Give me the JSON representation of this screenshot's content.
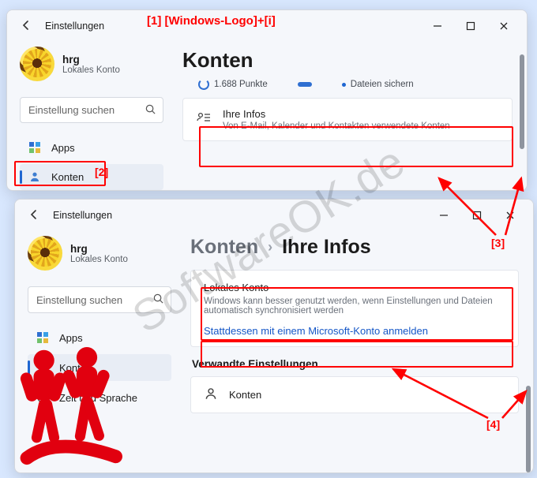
{
  "watermark": "SoftwareOK.de",
  "annotation": {
    "hotkey": "[1]  [Windows-Logo]+[i]",
    "n2": "[2]",
    "n3": "[3]",
    "n4": "[4]"
  },
  "win1": {
    "title": "Einstellungen",
    "user": {
      "name": "hrg",
      "sub": "Lokales Konto"
    },
    "search_placeholder": "Einstellung suchen",
    "heading": "Konten",
    "status": {
      "points": "1.688 Punkte",
      "backup": "Dateien sichern"
    },
    "nav": [
      {
        "icon": "apps",
        "label": "Apps"
      },
      {
        "icon": "person",
        "label": "Konten"
      }
    ],
    "card": {
      "title": "Ihre Infos",
      "sub": "Von E-Mail, Kalender und Kontakten verwendete Konten"
    }
  },
  "win2": {
    "title": "Einstellungen",
    "user": {
      "name": "hrg",
      "sub": "Lokales Konto"
    },
    "search_placeholder": "Einstellung suchen",
    "crumb": {
      "a": "Konten",
      "b": "Ihre Infos"
    },
    "nav": [
      {
        "icon": "apps",
        "label": "Apps"
      },
      {
        "icon": "person",
        "label": "Konten"
      },
      {
        "icon": "clock",
        "label": "Zeit und Sprache"
      }
    ],
    "local": {
      "title": "Lokales Konto",
      "sub": "Windows kann besser genutzt werden, wenn Einstellungen und Dateien automatisch synchronisiert werden",
      "link": "Stattdessen mit einem Microsoft-Konto anmelden"
    },
    "related_heading": "Verwandte Einstellungen",
    "related_item": "Konten"
  }
}
